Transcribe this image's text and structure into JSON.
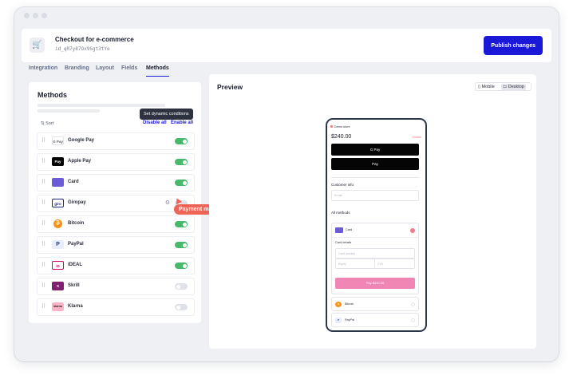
{
  "header": {
    "title": "Checkout for e-commerce",
    "id": "id_qR7y87Ox9Sgt3tYe",
    "publish_label": "Publish changes"
  },
  "tabs": [
    {
      "label": "Integration"
    },
    {
      "label": "Branding"
    },
    {
      "label": "Layout"
    },
    {
      "label": "Fields"
    },
    {
      "label": "Methods",
      "active": true
    }
  ],
  "methods_panel": {
    "title": "Methods",
    "sort_label": "Sort",
    "disable_all": "Disable all",
    "enable_all": "Enable all",
    "items": [
      {
        "name": "Google Pay",
        "logo": "G Pay",
        "enabled": true
      },
      {
        "name": "Apple Pay",
        "logo": "Pay",
        "enabled": true
      },
      {
        "name": "Card",
        "logo": "",
        "enabled": true
      },
      {
        "name": "Giropay",
        "logo": "giro",
        "enabled": false
      },
      {
        "name": "Bitcoin",
        "logo": "₿",
        "enabled": true
      },
      {
        "name": "PayPal",
        "logo": "P",
        "enabled": true
      },
      {
        "name": "iDEAL",
        "logo": "iD",
        "enabled": true
      },
      {
        "name": "Skrill",
        "logo": "S",
        "enabled": false
      },
      {
        "name": "Klarna",
        "logo": "klarna",
        "enabled": false
      }
    ],
    "tooltip": "Set dynamic conditions",
    "callout": "Payment manager"
  },
  "preview": {
    "title": "Preview",
    "device_mobile": "Mobile",
    "device_desktop": "Desktop",
    "phone": {
      "store": "Demo store",
      "amount": "$240.00",
      "details": "Details",
      "gpay": "G Pay",
      "applepay": " Pay",
      "customer_info": "Customer info",
      "email_placeholder": "Email",
      "all_methods": "All methods",
      "card": "Card",
      "card_details": "Card details",
      "card_number": "Card number",
      "expiry": "Expiry",
      "cvv": "CVV",
      "pay_button": "Pay $240.00",
      "bitcoin": "Bitcoin",
      "paypal": "PayPal"
    }
  },
  "colors": {
    "accent": "#1a19d8",
    "toggle_on": "#48b96a",
    "callout": "#ee6456",
    "pay_button": "#ef86b4"
  }
}
